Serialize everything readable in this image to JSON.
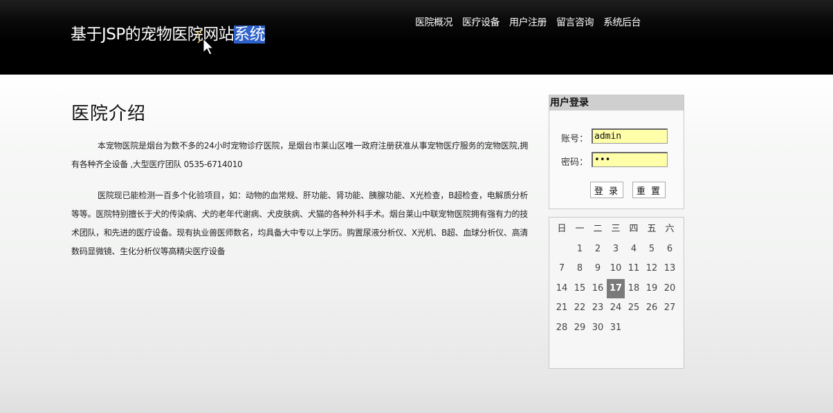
{
  "header": {
    "title_main": "基于JSP的宠物医院网站",
    "title_selected": "系统",
    "nav": [
      "医院概况",
      "医疗设备",
      "用户注册",
      "留言咨询",
      "系统后台"
    ]
  },
  "content": {
    "title": "医院介绍",
    "paragraphs": [
      "本宠物医院是烟台为数不多的24小时宠物诊疗医院，是烟台市莱山区唯一政府注册获准从事宠物医疗服务的宠物医院,拥有各种齐全设备 ,大型医疗团队 0535-6714010",
      "医院现已能检测一百多个化验项目，如：动物的血常规、肝功能、肾功能、胰腺功能、X光检查，B超检查，电解质分析等等。医院特别擅长于犬的传染病、犬的老年代谢病、犬皮肤病、犬猫的各种外科手术。烟台莱山中联宠物医院拥有强有力的技术团队，和先进的医疗设备。现有执业兽医师数名，均具备大中专以上学历。购置尿液分析仪、X光机、B超、血球分析仪、高清数码显微镜、生化分析仪等高精尖医疗设备"
    ]
  },
  "login": {
    "title": "用户登录",
    "username_label": "账号：",
    "username_value": "admin",
    "password_label": "密码：",
    "password_value": "•••",
    "login_button": "登 录",
    "reset_button": "重 置"
  },
  "calendar": {
    "weekdays": [
      "日",
      "一",
      "二",
      "三",
      "四",
      "五",
      "六"
    ],
    "leading_blanks": 1,
    "days": [
      1,
      2,
      3,
      4,
      5,
      6,
      7,
      8,
      9,
      10,
      11,
      12,
      13,
      14,
      15,
      16,
      17,
      18,
      19,
      20,
      21,
      22,
      23,
      24,
      25,
      26,
      27,
      28,
      29,
      30,
      31
    ],
    "today": 17,
    "today_color": "#7a7a7a"
  },
  "colors": {
    "header_bg": "#000000",
    "selection_bg": "#2f62c9",
    "input_bg": "#ffffaa"
  }
}
